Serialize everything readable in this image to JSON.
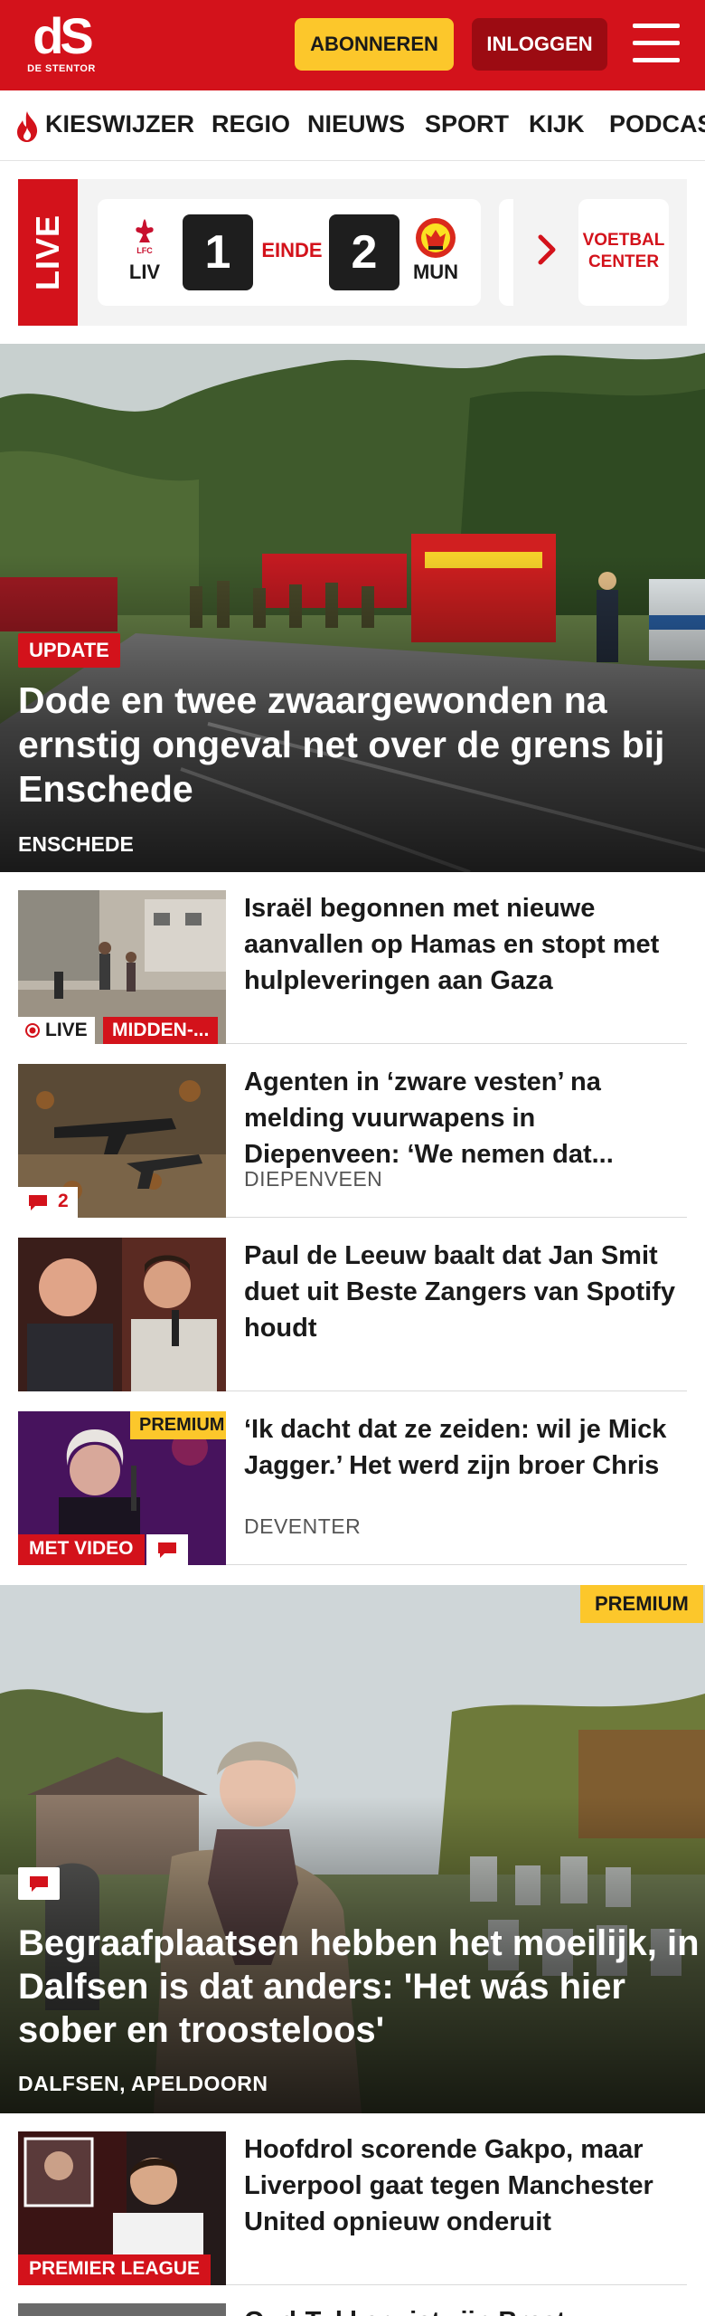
{
  "brand": {
    "logo_mark": "dS",
    "logo_sub": "DE STENTOR"
  },
  "header": {
    "subscribe_label": "ABONNEREN",
    "login_label": "INLOGGEN"
  },
  "nav": {
    "items": [
      "KIESWIJZER",
      "REGIO",
      "NIEUWS",
      "SPORT",
      "KIJK",
      "PODCAS"
    ]
  },
  "live": {
    "tab_label": "LIVE",
    "match": {
      "home_team": "LIV",
      "home_score": "1",
      "status": "EINDE",
      "away_score": "2",
      "away_team": "MUN"
    },
    "football_center": "VOETBAL CENTER"
  },
  "hero": {
    "tag": "UPDATE",
    "title": "Dode en twee zwaargewonden na ernstig ongeval net over de grens bij Enschede",
    "location": "ENSCHEDE"
  },
  "articles": [
    {
      "title": "Israël begonnen met nieuwe aanvallen op Hamas en stopt met hulpleveringen aan Gaza",
      "live_label": "LIVE",
      "section_tag": "MIDDEN-..."
    },
    {
      "title": "Agenten in ‘zware vesten’ na melding vuurwapens in Diepenveen: ‘We nemen dat...",
      "location": "DIEPENVEEN",
      "comment_count": "2"
    },
    {
      "title": "Paul de Leeuw baalt dat Jan Smit duet uit Beste Zangers van Spotify houdt"
    },
    {
      "title": "‘Ik dacht dat ze zeiden: wil je Mick Jagger.’ Het werd zijn broer Chris",
      "location": "DEVENTER",
      "premium_label": "PREMIUM",
      "video_label": "MET VIDEO"
    }
  ],
  "hero2": {
    "premium_label": "PREMIUM",
    "title": "Begraafplaatsen hebben het moeilijk, in Dalfsen is dat anders: 'Het wás hier sober en troosteloos'",
    "location": "DALFSEN, APELDOORN"
  },
  "article_last": {
    "title": "Hoofdrol scorende Gakpo, maar Liverpool gaat tegen Manchester United opnieuw onderuit",
    "section_tag": "PREMIER LEAGUE"
  },
  "article_peek": {
    "title": "Oud-Tukker ziet zijn Brest..."
  },
  "colors": {
    "brand_red": "#d3121b",
    "premium_yellow": "#fcc72b",
    "login_dark_red": "#9c0b12"
  }
}
